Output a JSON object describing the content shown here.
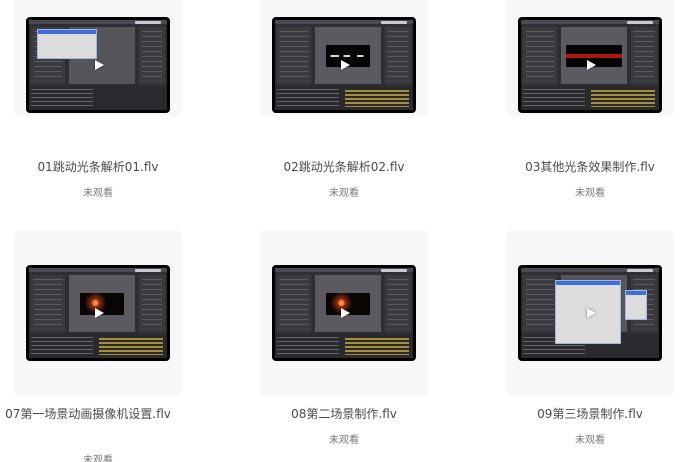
{
  "videos": [
    {
      "title": "01跳动光条解析01.flv",
      "status": "未观看"
    },
    {
      "title": "02跳动光条解析02.flv",
      "status": "未观看"
    },
    {
      "title": "03其他光条效果制作.flv",
      "status": "未观看"
    },
    {
      "title": "07第一场景动画摄像机设置.flv",
      "status": "未观看"
    },
    {
      "title": "08第二场景制作.flv",
      "status": "未观看"
    },
    {
      "title": "09第三场景制作.flv",
      "status": "未观看"
    }
  ],
  "icons": {
    "thumbnail_overlay": "play-icon"
  },
  "colors": {
    "title_text": "#4a4a4a",
    "status_text": "#7a7a7a",
    "card_bg": "#f7f7f8"
  }
}
